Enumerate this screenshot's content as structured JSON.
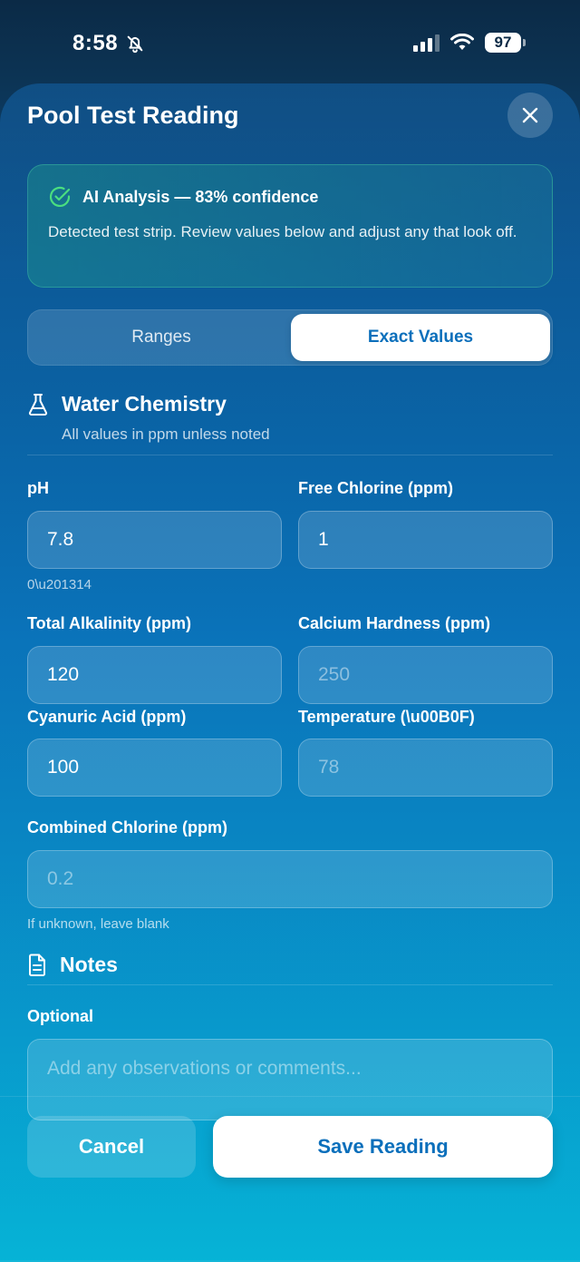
{
  "status": {
    "time": "8:58",
    "battery": "97",
    "icons": [
      "bell-slash-icon",
      "signal-icon",
      "wifi-icon",
      "battery-icon"
    ]
  },
  "sheet": {
    "title": "Pool Test Reading",
    "close_icon": "close-icon"
  },
  "ai": {
    "title": "AI Analysis — 83% confidence",
    "body": "Detected test strip. Review values below and adjust any that look off.",
    "icon": "check-circle-icon",
    "accent": "#4ade80"
  },
  "segment": {
    "ranges": "Ranges",
    "exact": "Exact Values",
    "selected": "Exact Values"
  },
  "chemistry": {
    "title": "Water Chemistry",
    "subtitle": "All values in ppm unless noted",
    "icon": "flask-icon",
    "fields": {
      "ph": {
        "label": "pH",
        "value": "7.8",
        "hint": "0\\u201314"
      },
      "free_chlorine": {
        "label": "Free Chlorine (ppm)",
        "value": "1"
      },
      "alkalinity": {
        "label": "Total Alkalinity (ppm)",
        "value": "120"
      },
      "calcium": {
        "label": "Calcium Hardness (ppm)",
        "placeholder": "250"
      },
      "cya": {
        "label": "Cyanuric Acid (ppm)",
        "value": "100"
      },
      "temperature": {
        "label": "Temperature (\\u00B0F)",
        "placeholder": "78"
      },
      "combined_chlorine": {
        "label": "Combined Chlorine (ppm)",
        "placeholder": "0.2",
        "hint": "If unknown, leave blank"
      }
    }
  },
  "notes": {
    "title": "Notes",
    "icon": "document-icon",
    "label": "Optional",
    "placeholder": "Add any observations or comments..."
  },
  "footer": {
    "cancel": "Cancel",
    "save": "Save Reading"
  },
  "colors": {
    "primary_text": "#0b6fbb"
  }
}
